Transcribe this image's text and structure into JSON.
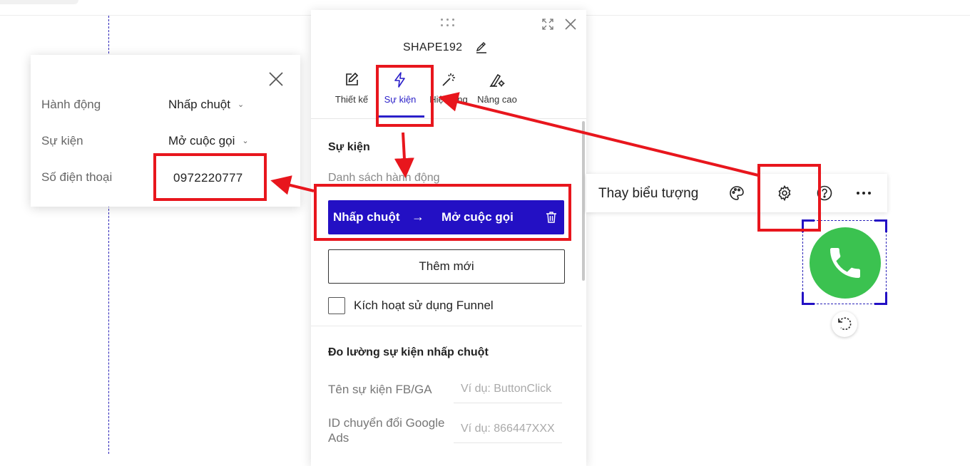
{
  "panel": {
    "shape_name": "SHAPE192",
    "tabs": [
      {
        "label": "Thiết kế",
        "icon": "edit-square-icon"
      },
      {
        "label": "Sự kiện",
        "icon": "lightning-icon",
        "active": true
      },
      {
        "label": "Hiệu ứng",
        "icon": "magic-wand-icon"
      },
      {
        "label": "Nâng cao",
        "icon": "pen-gear-icon"
      }
    ],
    "section_event_title": "Sự kiện",
    "action_list_label": "Danh sách hành động",
    "action_row": {
      "trigger": "Nhấp chuột",
      "arrow": "→",
      "action": "Mở cuộc gọi"
    },
    "add_button": "Thêm mới",
    "funnel_checkbox_label": "Kích hoạt sử dụng Funnel",
    "tracking_title": "Đo lường sự kiện nhấp chuột",
    "fb_ga_label": "Tên sự kiện FB/GA",
    "fb_ga_placeholder": "Ví dụ: ButtonClick",
    "gads_label": "ID chuyển đổi Google Ads",
    "gads_placeholder": "Ví dụ: 866447XXX"
  },
  "popup": {
    "rows": [
      {
        "label": "Hành động",
        "value": "Nhấp chuột"
      },
      {
        "label": "Sự kiện",
        "value": "Mở cuộc gọi"
      },
      {
        "label": "Số điện thoại",
        "value": "0972220777"
      }
    ]
  },
  "toolbar": {
    "label": "Thay biểu tượng",
    "icons": [
      "palette-icon",
      "gear-icon",
      "help-icon",
      "more-icon"
    ]
  },
  "colors": {
    "accent": "#2310c4",
    "annotation_red": "#e8161d",
    "phone_green": "#3bc250"
  }
}
